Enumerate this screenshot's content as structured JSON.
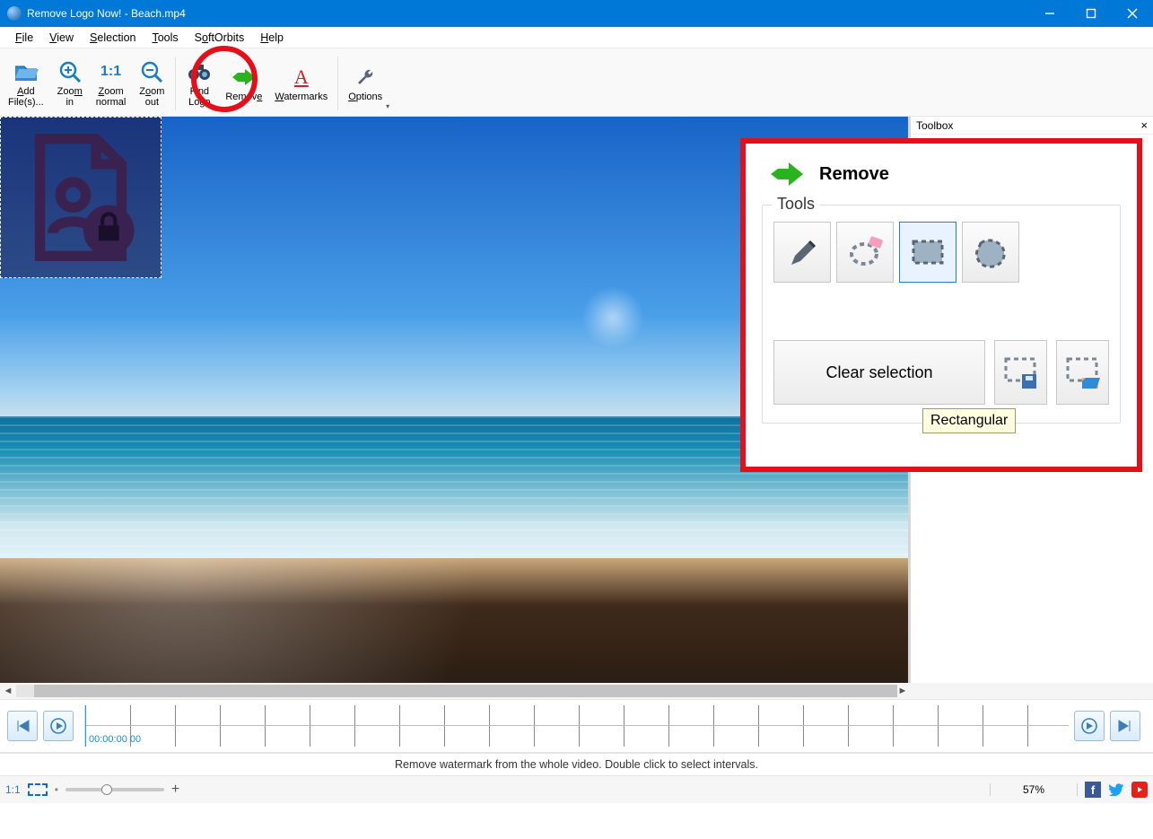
{
  "window": {
    "title": "Remove Logo Now! - Beach.mp4"
  },
  "menu": {
    "file": "File",
    "view": "View",
    "selection": "Selection",
    "tools": "Tools",
    "softorbits": "SoftOrbits",
    "help": "Help"
  },
  "toolbar": {
    "add": "Add File(s)...",
    "zoomIn": "Zoom in",
    "zoomNormal": "Zoom normal",
    "zoomOut": "Zoom out",
    "findLogo": "Find Logo",
    "remove": "Remove",
    "watermarks": "Watermarks",
    "options": "Options"
  },
  "toolbox": {
    "title": "Toolbox",
    "panelTitle": "Remove",
    "groupLabel": "Tools",
    "tooltip": "Rectangular",
    "clear": "Clear selection"
  },
  "timeline": {
    "timecode": "00:00:00 00"
  },
  "hint": "Remove watermark from the whole video. Double click to select intervals.",
  "status": {
    "ratio": "1:1",
    "zoom": "57%"
  }
}
